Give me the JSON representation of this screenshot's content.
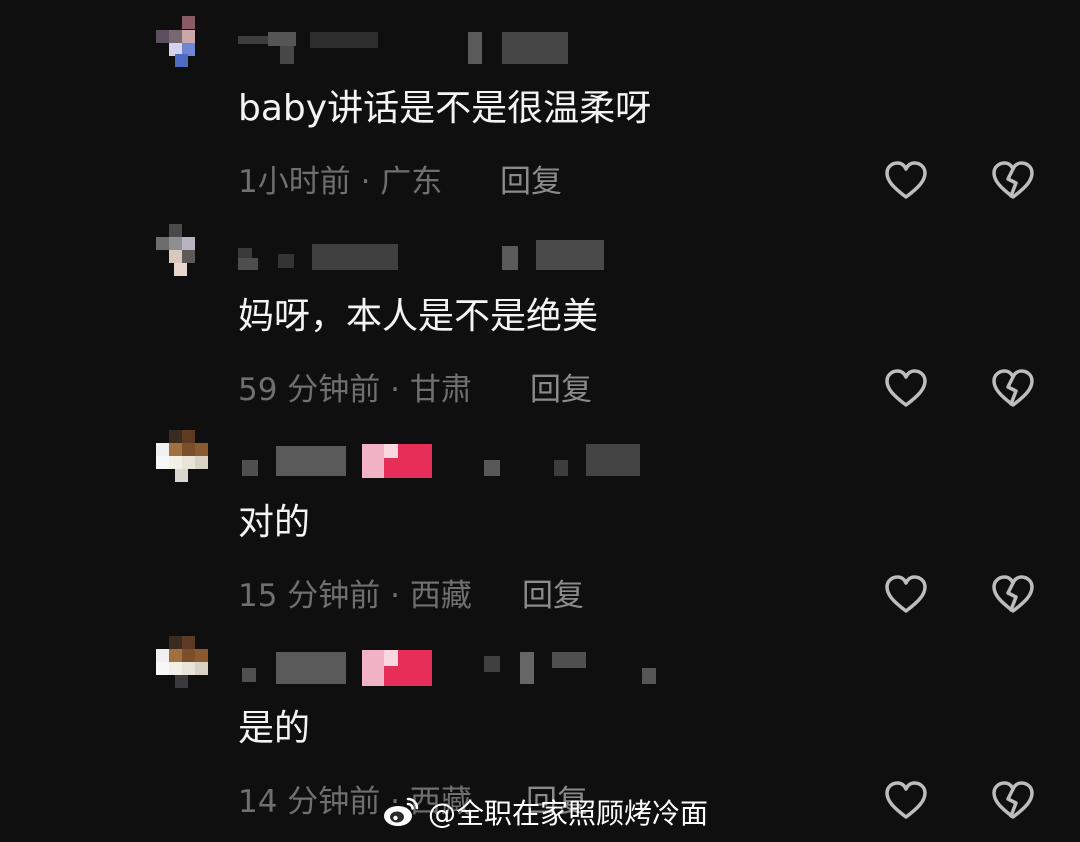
{
  "comments": [
    {
      "text": "baby讲话是不是很温柔呀",
      "meta": "1小时前 · 广东",
      "reply_label": "回复"
    },
    {
      "text": "妈呀，本人是不是绝美",
      "meta": "59 分钟前 · 甘肃",
      "reply_label": "回复"
    },
    {
      "text": "对的",
      "meta": "15 分钟前 · 西藏",
      "reply_label": "回复"
    },
    {
      "text": "是的",
      "meta": "14 分钟前 · 西藏",
      "reply_label": "回复"
    }
  ],
  "watermark": {
    "text": "@全职在家照顾烤冷面"
  },
  "icons": {
    "like": "heart-outline-icon",
    "dislike": "broken-heart-icon",
    "logo": "weibo-logo-icon"
  },
  "colors": {
    "background": "#0f0f0f",
    "text": "#f4f4f4",
    "meta": "#6f6f6f",
    "reply": "#8b8b8b",
    "icon": "#bdbdbd",
    "badge": "#e62e58"
  }
}
